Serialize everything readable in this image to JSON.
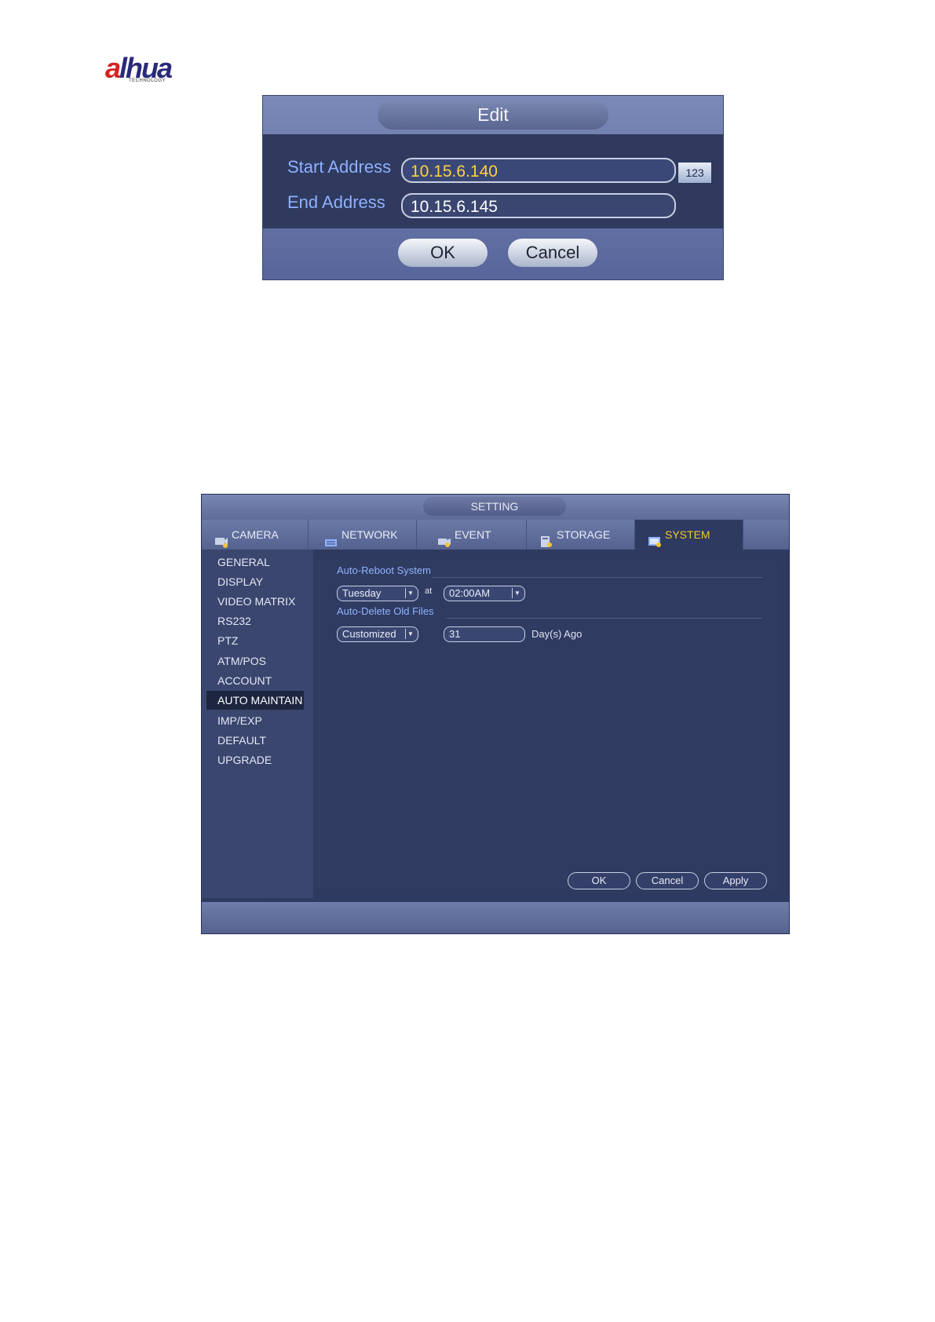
{
  "logo": {
    "brand": "alhua",
    "tagline": "TECHNOLOGY"
  },
  "edit_dialog": {
    "title": "Edit",
    "start_label": "Start Address",
    "start_value": "10.15.6.140",
    "end_label": "End Address",
    "end_value": "10.15.6.145",
    "keyboard_button": "123",
    "ok": "OK",
    "cancel": "Cancel"
  },
  "setting": {
    "title": "SETTING",
    "tabs": [
      {
        "label": "CAMERA",
        "icon": "camera-icon"
      },
      {
        "label": "NETWORK",
        "icon": "network-icon"
      },
      {
        "label": "EVENT",
        "icon": "event-icon"
      },
      {
        "label": "STORAGE",
        "icon": "storage-icon"
      },
      {
        "label": "SYSTEM",
        "icon": "system-icon",
        "active": true
      }
    ],
    "sidebar": [
      "GENERAL",
      "DISPLAY",
      "VIDEO MATRIX",
      "RS232",
      "PTZ",
      "ATM/POS",
      "ACCOUNT",
      "AUTO MAINTAIN",
      "IMP/EXP",
      "DEFAULT",
      "UPGRADE"
    ],
    "sidebar_active": "AUTO MAINTAIN",
    "auto_reboot": {
      "title": "Auto-Reboot System",
      "day": "Tuesday",
      "at_label": "at",
      "time": "02:00AM"
    },
    "auto_delete": {
      "title": "Auto-Delete Old Files",
      "mode": "Customized",
      "days": "31",
      "suffix": "Day(s) Ago"
    },
    "buttons": {
      "ok": "OK",
      "cancel": "Cancel",
      "apply": "Apply"
    },
    "colors": {
      "accent": "#f5c730",
      "label_blue": "#8fb3ff",
      "panel": "#2e3a5f"
    }
  }
}
